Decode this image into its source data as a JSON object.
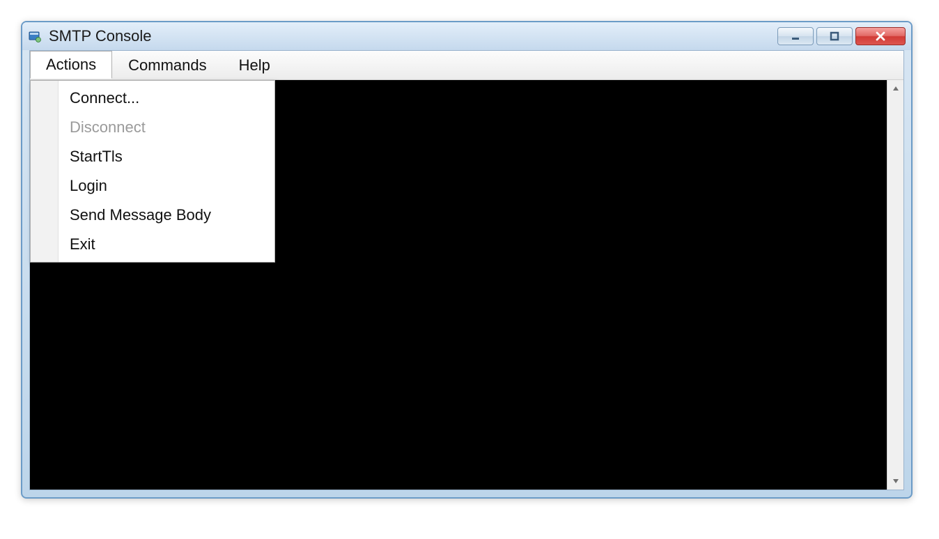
{
  "window": {
    "title": "SMTP Console"
  },
  "menubar": {
    "items": [
      {
        "label": "Actions",
        "open": true
      },
      {
        "label": "Commands",
        "open": false
      },
      {
        "label": "Help",
        "open": false
      }
    ]
  },
  "actions_menu": {
    "items": [
      {
        "label": "Connect...",
        "enabled": true
      },
      {
        "label": "Disconnect",
        "enabled": false
      },
      {
        "label": "StartTls",
        "enabled": true
      },
      {
        "label": "Login",
        "enabled": true
      },
      {
        "label": "Send Message Body",
        "enabled": true
      },
      {
        "label": "Exit",
        "enabled": true
      }
    ]
  },
  "console": {
    "visible_text": "("
  }
}
